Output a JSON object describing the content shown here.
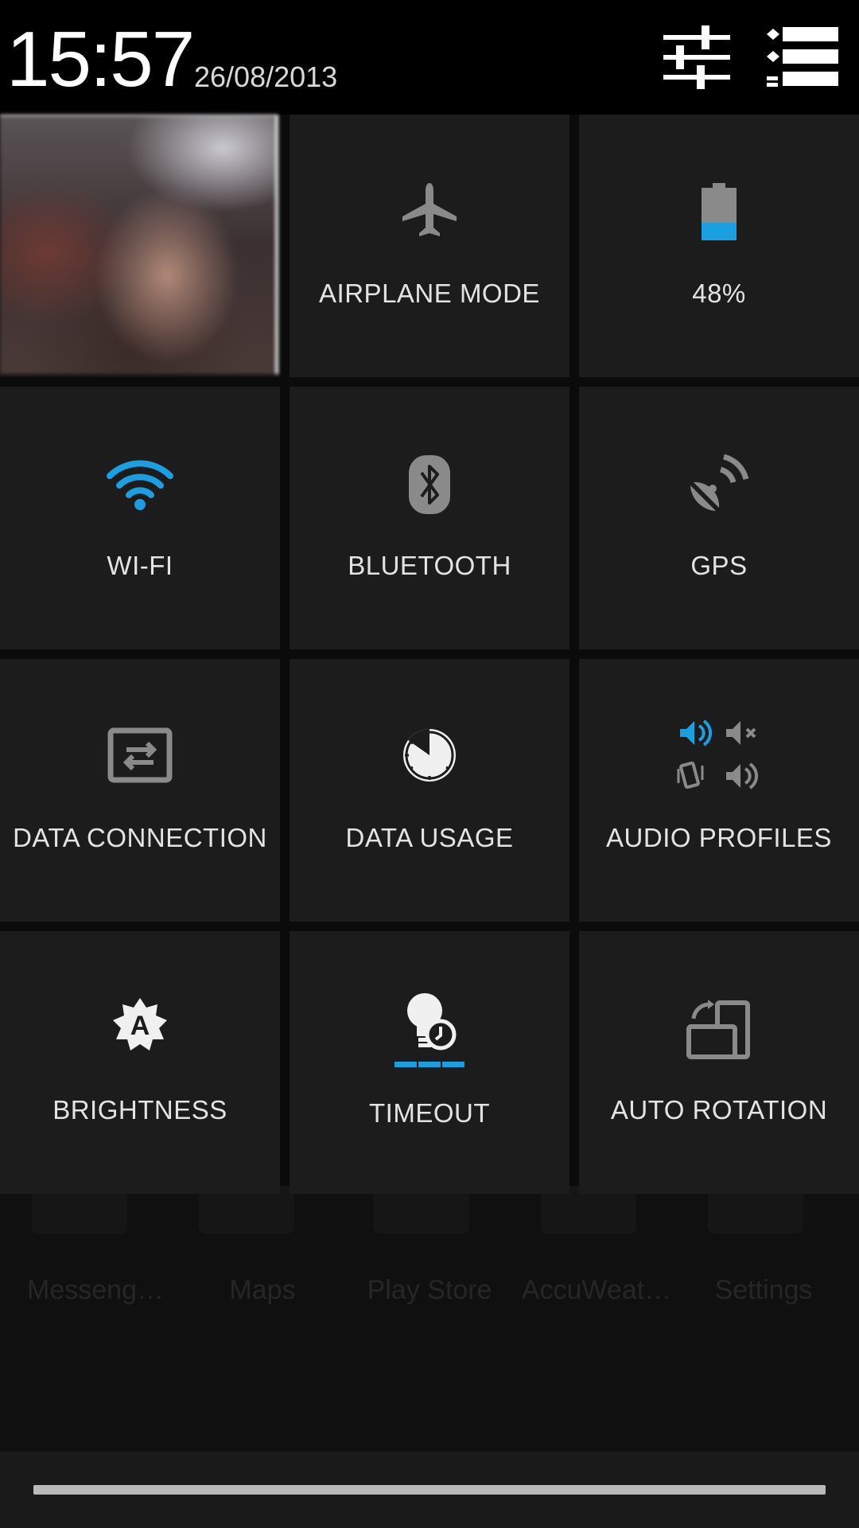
{
  "status": {
    "time": "15:57",
    "date": "26/08/2013"
  },
  "tiles": [
    {
      "id": "user",
      "label": ""
    },
    {
      "id": "airplane",
      "label": "AIRPLANE MODE"
    },
    {
      "id": "battery",
      "label": "48%"
    },
    {
      "id": "wifi",
      "label": "WI-FI"
    },
    {
      "id": "bluetooth",
      "label": "BLUETOOTH"
    },
    {
      "id": "gps",
      "label": "GPS"
    },
    {
      "id": "data_connection",
      "label": "DATA CONNECTION"
    },
    {
      "id": "data_usage",
      "label": "DATA USAGE"
    },
    {
      "id": "audio_profiles",
      "label": "AUDIO PROFILES"
    },
    {
      "id": "brightness",
      "label": "BRIGHTNESS"
    },
    {
      "id": "timeout",
      "label": "TIMEOUT"
    },
    {
      "id": "auto_rotation",
      "label": "AUTO ROTATION"
    }
  ],
  "battery_level": 0.48,
  "colors": {
    "accent": "#1a9fe0",
    "tile": "#1c1c1c",
    "icon_gray": "#8a8a8a"
  },
  "dock": [
    "Messeng…",
    "Maps",
    "Play Store",
    "AccuWeat…",
    "Settings"
  ]
}
